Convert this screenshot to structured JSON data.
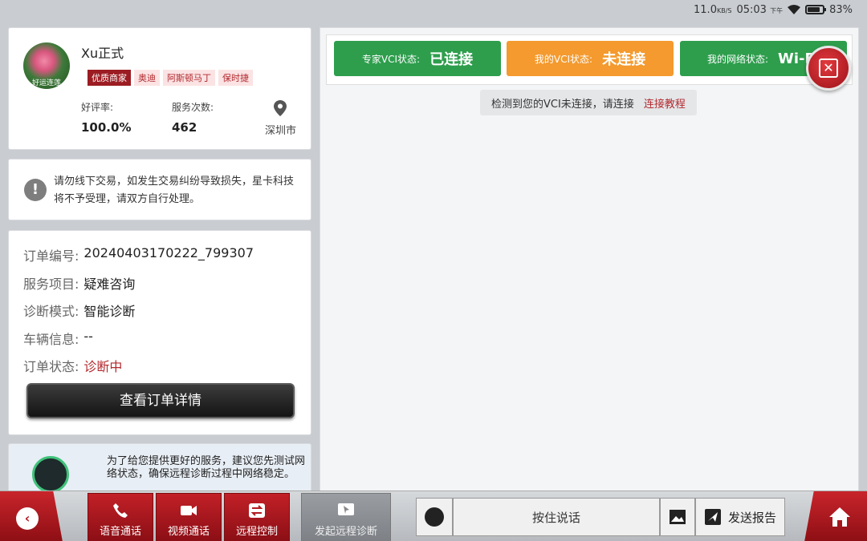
{
  "status_bar": {
    "speed": "11.0",
    "speed_unit": "KB/S",
    "time": "05:03",
    "ampm": "下午",
    "battery": "83%"
  },
  "profile": {
    "avatar_text": "好运连莲",
    "name": "Xu正式",
    "tags": [
      "优质商家",
      "奥迪",
      "阿斯顿马丁",
      "保时捷"
    ],
    "rating_label": "好评率:",
    "rating_value": "100.0%",
    "service_label": "服务次数:",
    "service_value": "462",
    "location": "深圳市"
  },
  "notice": {
    "text": "请勿线下交易，如发生交易纠纷导致损失，星卡科技将不予受理，请双方自行处理。"
  },
  "order": {
    "rows": [
      {
        "label": "订单编号:",
        "value": "20240403170222_799307"
      },
      {
        "label": "服务项目:",
        "value": "疑难咨询"
      },
      {
        "label": "诊断模式:",
        "value": "智能诊断"
      },
      {
        "label": "车辆信息:",
        "value": "--"
      },
      {
        "label": "订单状态:",
        "value": "诊断中"
      }
    ],
    "detail_button": "查看订单详情"
  },
  "network_tip": {
    "text": "为了给您提供更好的服务，建议您先测试网络状态，确保远程诊断过程中网络稳定。"
  },
  "vci_status": [
    {
      "label": "专家VCI状态:",
      "value": "已连接"
    },
    {
      "label": "我的VCI状态:",
      "value": "未连接"
    },
    {
      "label": "我的网络状态:",
      "value": "Wi-Fi"
    }
  ],
  "hint": {
    "text": "检测到您的VCI未连接，请连接",
    "link": "连接教程"
  },
  "bottom": {
    "tabs": [
      "语音通话",
      "视频通话",
      "远程控制",
      "发起远程诊断"
    ],
    "talk": "按住说话",
    "report": "发送报告"
  },
  "colors": {
    "brand_red": "#b01a20",
    "green": "#2e9e4d",
    "orange": "#f49a2e"
  }
}
